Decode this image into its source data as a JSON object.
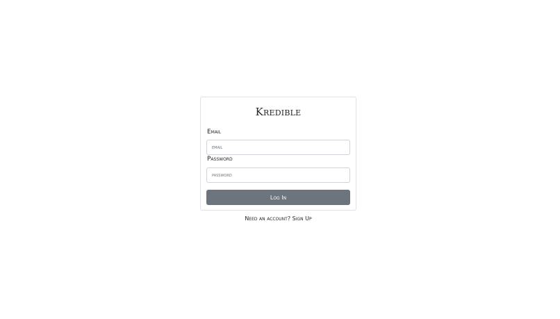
{
  "app": {
    "title": "Kredible"
  },
  "form": {
    "email_label": "Email",
    "email_placeholder": "email",
    "email_value": "",
    "password_label": "Password",
    "password_placeholder": "password",
    "password_value": "",
    "login_button": "Log In"
  },
  "footer": {
    "prompt": "Need an account?",
    "signup_link": "Sign Up"
  },
  "colors": {
    "button_bg": "#6c757d",
    "border": "#ced4da",
    "text": "#212529"
  }
}
